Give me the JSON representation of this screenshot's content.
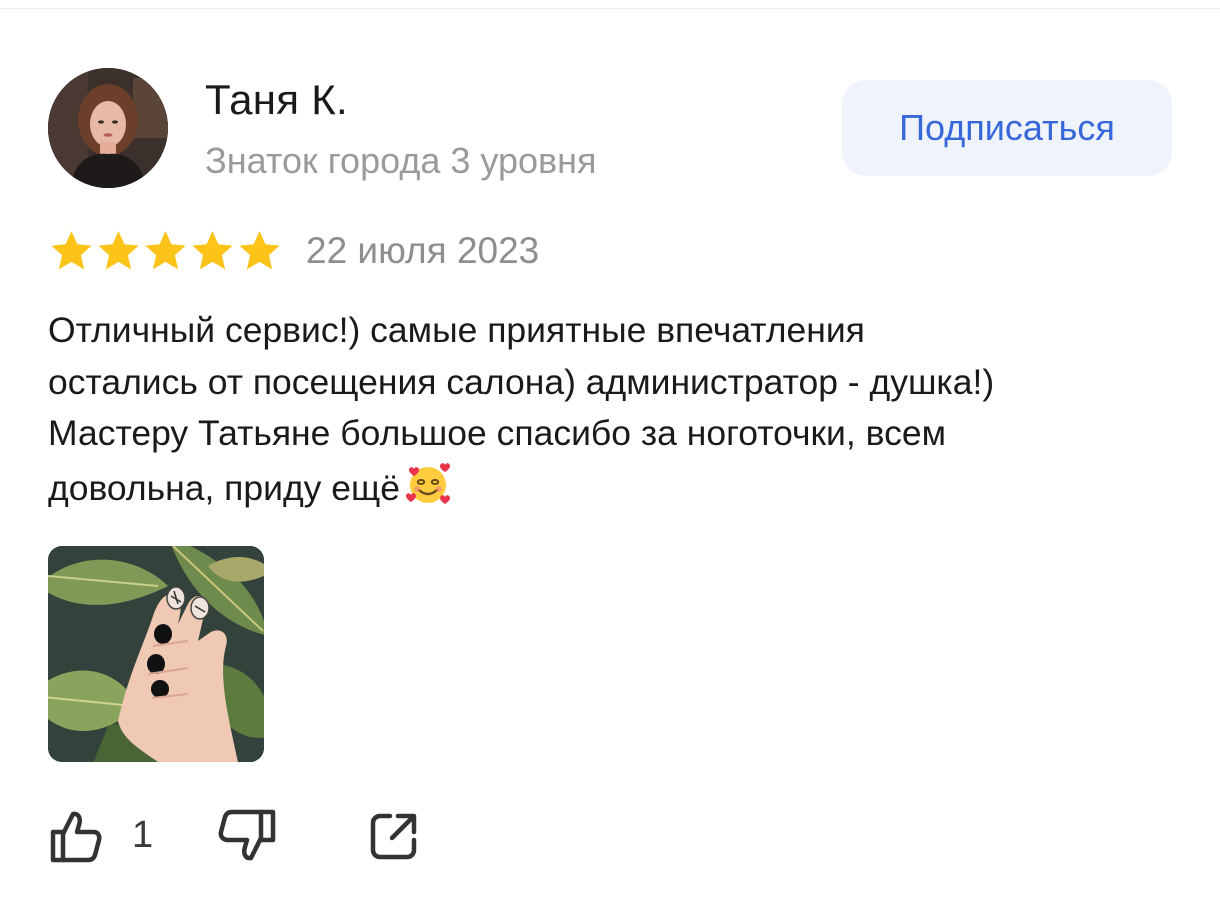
{
  "review": {
    "author": {
      "name": "Таня К.",
      "level": "Знаток города 3 уровня",
      "avatar_icon": "user-avatar-photo"
    },
    "subscribe_label": "Подписаться",
    "rating": {
      "value": 5,
      "max": 5,
      "star_color": "#fcc419"
    },
    "date": "22 июля 2023",
    "text_lines": [
      "Отличный сервис!) самые приятные впечатления",
      "остались от посещения салона) администратор - душка!)",
      "Мастеру Татьяне большое спасибо за ноготочки, всем",
      "довольна, приду ещё"
    ],
    "emoji": "smiling-face-with-hearts",
    "photo_icon": "review-photo-manicure",
    "actions": {
      "like_icon": "thumbs-up-icon",
      "like_count": "1",
      "dislike_icon": "thumbs-down-icon",
      "share_icon": "share-icon"
    }
  },
  "colors": {
    "accent": "#3867d9",
    "subscribe_bg": "#eef3fc",
    "secondary_text": "#9a9a9a"
  }
}
